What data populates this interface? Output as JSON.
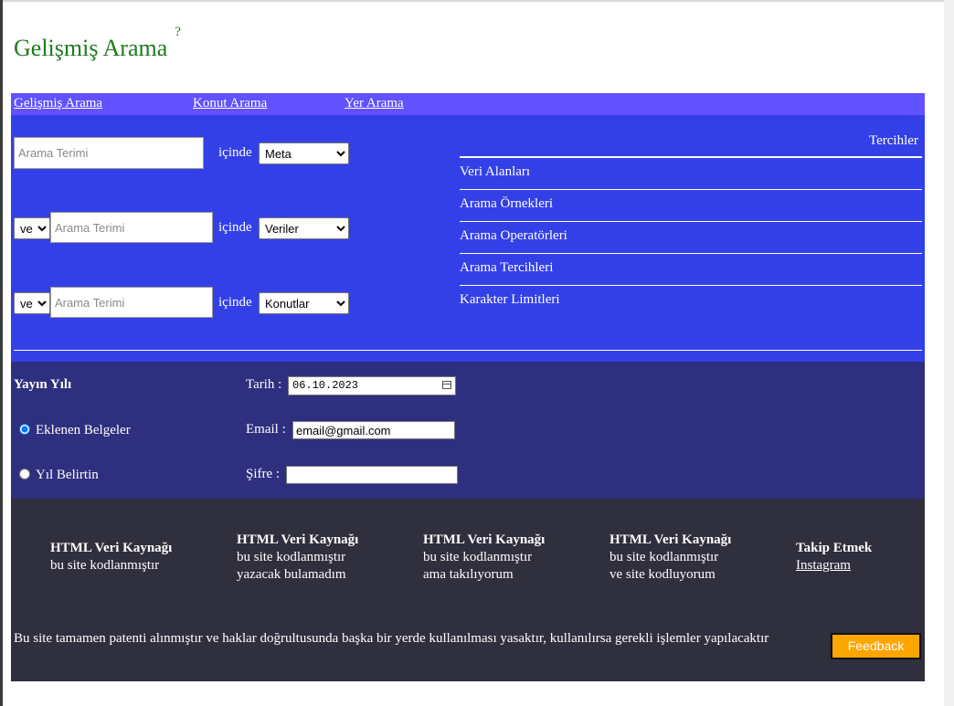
{
  "header": {
    "title": "Gelişmiş Arama",
    "help_mark": "?"
  },
  "nav": {
    "items": [
      {
        "label": "Gelişmiş Arama"
      },
      {
        "label": "Konut Arama"
      },
      {
        "label": "Yer Arama"
      }
    ]
  },
  "search": {
    "rows": [
      {
        "operator": "",
        "term_placeholder": "Arama Terimi",
        "term_value": "",
        "within_label": "içinde",
        "field": "Meta"
      },
      {
        "operator": "ve",
        "term_placeholder": "Arama Terimi",
        "term_value": "",
        "within_label": "içinde",
        "field": "Veriler"
      },
      {
        "operator": "veya",
        "term_placeholder": "Arama Terimi",
        "term_value": "",
        "within_label": "içinde",
        "field": "Konutlar"
      }
    ]
  },
  "preferences": {
    "title": "Tercihler",
    "items": [
      {
        "label": "Veri Alanları"
      },
      {
        "label": "Arama Örnekleri"
      },
      {
        "label": "Arama Operatörleri"
      },
      {
        "label": "Arama Tercihleri"
      },
      {
        "label": "Karakter Limitleri"
      }
    ]
  },
  "publication": {
    "year_label": "Yayın Yılı",
    "options": [
      {
        "label": "Eklenen Belgeler",
        "checked": true
      },
      {
        "label": "Yıl Belirtin",
        "checked": false
      }
    ],
    "date_label": "Tarih :",
    "date_value": "06.10.2023",
    "email_label": "Email :",
    "email_value": "email@gmail.com",
    "password_label": "Şifre :",
    "password_value": ""
  },
  "footer": {
    "columns": [
      {
        "head": "HTML Veri Kaynağı",
        "lines": [
          "bu site kodlanmıştır"
        ]
      },
      {
        "head": "HTML Veri Kaynağı",
        "lines": [
          "bu site kodlanmıştır",
          "yazacak bulamadım"
        ]
      },
      {
        "head": "HTML Veri Kaynağı",
        "lines": [
          "bu site kodlanmıştır",
          "ama takılıyorum"
        ]
      },
      {
        "head": "HTML Veri Kaynağı",
        "lines": [
          "bu site kodlanmıştır",
          "ve site kodluyorum"
        ]
      }
    ],
    "follow": {
      "head": "Takip Etmek",
      "link": "Instagram"
    },
    "copyright": "Bu site tamamen patenti alınmıştır ve haklar doğrultusunda başka bir yerde kullanılması yasaktır, kullanılırsa gerekli işlemler yapılacaktır",
    "feedback_label": "Feedback"
  },
  "colors": {
    "title_green": "#1e7a1e",
    "nav_bg": "#6151ff",
    "search_bg": "#3340e8",
    "publication_bg": "#2f2f80",
    "footer_bg": "#2f2f3e",
    "feedback_bg": "#ffa500"
  }
}
